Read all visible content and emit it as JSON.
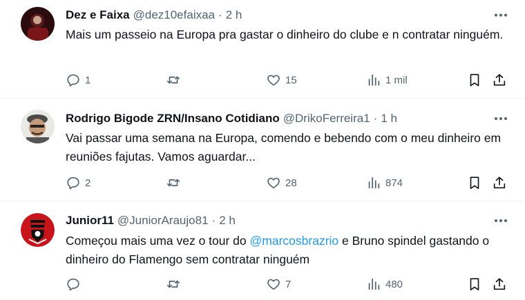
{
  "colors": {
    "text": "#0f1419",
    "muted": "#536471",
    "link": "#1d9bf0",
    "divider": "#eff3f4"
  },
  "icons": [
    "reply-icon",
    "retweet-icon",
    "like-icon",
    "views-icon",
    "bookmark-icon",
    "share-icon",
    "more-icon"
  ],
  "tweets": [
    {
      "name": "Dez e Faixa",
      "handle": "@dez10efaixaa",
      "dot": "·",
      "time": "2 h",
      "text": "Mais um passeio na Europa pra gastar o dinheiro do clube e n contratar ninguém.",
      "replies": "1",
      "retweets": "",
      "likes": "15",
      "views": "1 mil"
    },
    {
      "name": "Rodrigo Bigode ZRN/Insano Cotidiano",
      "handle": "@DrikoFerreira1",
      "dot": "·",
      "time": "1 h",
      "text": "Vai passar uma semana na Europa, comendo e bebendo com o meu dinheiro em reuniões fajutas. Vamos aguardar...",
      "replies": "2",
      "retweets": "",
      "likes": "28",
      "views": "874"
    },
    {
      "name": "Junior11",
      "handle": "@JuniorAraujo81",
      "dot": "·",
      "time": "2 h",
      "text_before": "Começou mais uma vez o tour do ",
      "mention": "@marcosbrazrio",
      "text_after": " e Bruno spindel gastando o dinheiro do Flamengo sem contratar ninguém",
      "replies": "",
      "retweets": "",
      "likes": "7",
      "views": "480"
    }
  ]
}
